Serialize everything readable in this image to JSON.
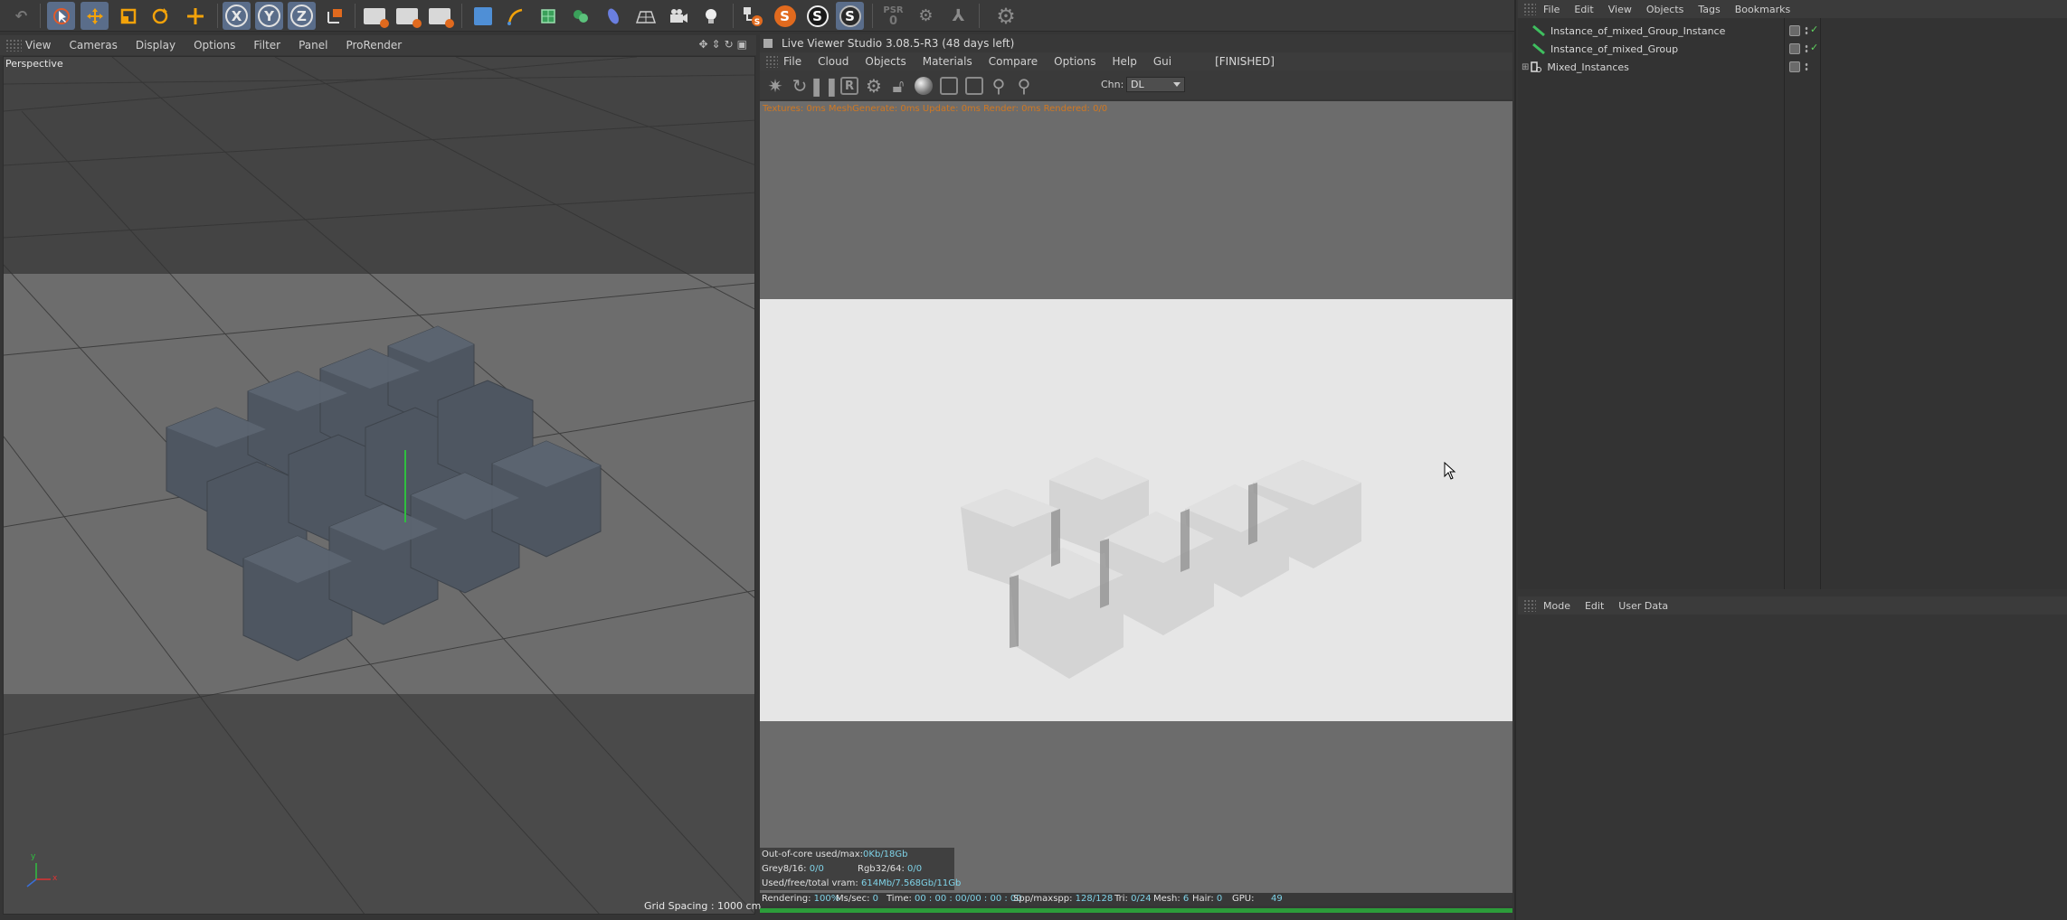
{
  "toolbar": {
    "axis_labels": [
      "X",
      "Y",
      "Z"
    ],
    "psr_label": "PSR",
    "psr_value": "0",
    "s_labels": [
      "S",
      "S",
      "S"
    ]
  },
  "viewport": {
    "menu": [
      "View",
      "Cameras",
      "Display",
      "Options",
      "Filter",
      "Panel",
      "ProRender"
    ],
    "label": "Perspective",
    "grid_spacing": "Grid Spacing : 1000 cm",
    "axis_x": "x",
    "axis_y": "y"
  },
  "live_viewer": {
    "title": "Live Viewer Studio 3.08.5-R3 (48 days left)",
    "menu": [
      "File",
      "Cloud",
      "Objects",
      "Materials",
      "Compare",
      "Options",
      "Help",
      "Gui"
    ],
    "status": "[FINISHED]",
    "chn_label": "Chn:",
    "chn_value": "DL",
    "info_line": "Textures: 0ms  MeshGenerate: 0ms  Update: 0ms  Render: 0ms  Rendered: 0/0",
    "stats": {
      "ooc_label": "Out-of-core used/max:",
      "ooc_value": "0Kb/18Gb",
      "grey_label": "Grey8/16:",
      "grey_value": "0/0",
      "rgb_label": "Rgb32/64:",
      "rgb_value": "0/0",
      "vram_label": "Used/free/total vram:",
      "vram_value": "614Mb/7.568Gb/11Gb"
    },
    "bottom": {
      "rendering_label": "Rendering:",
      "rendering_value": "100%",
      "ms_label": "Ms/sec:",
      "ms_value": "0",
      "time_label": "Time:",
      "time_value": "00 : 00 : 00/00 : 00 : 00",
      "spp_label": "Spp/maxspp:",
      "spp_value": "128/128",
      "tri_label": "Tri:",
      "tri_value": "0/24",
      "mesh_label": "Mesh:",
      "mesh_value": "6",
      "hair_label": "Hair:",
      "hair_value": "0",
      "gpu_label": "GPU:",
      "gpu_value": "49"
    },
    "progress": 1.0
  },
  "object_manager": {
    "menu": [
      "File",
      "Edit",
      "View",
      "Objects",
      "Tags",
      "Bookmarks"
    ],
    "objects": [
      {
        "name": "Instance_of_mixed_Group_Instance",
        "icon": "instance-icon"
      },
      {
        "name": "Instance_of_mixed_Group",
        "icon": "instance-icon"
      },
      {
        "name": "Mixed_Instances",
        "icon": "null-group-icon"
      }
    ]
  },
  "attribute_manager": {
    "menu": [
      "Mode",
      "Edit",
      "User Data"
    ]
  },
  "colors": {
    "accent_active": "#5a6d8a",
    "render_bg": "#e6e6e6",
    "progress": "#2c9c3a",
    "info_text": "#d07822",
    "stat_value": "#7fd3e8"
  }
}
